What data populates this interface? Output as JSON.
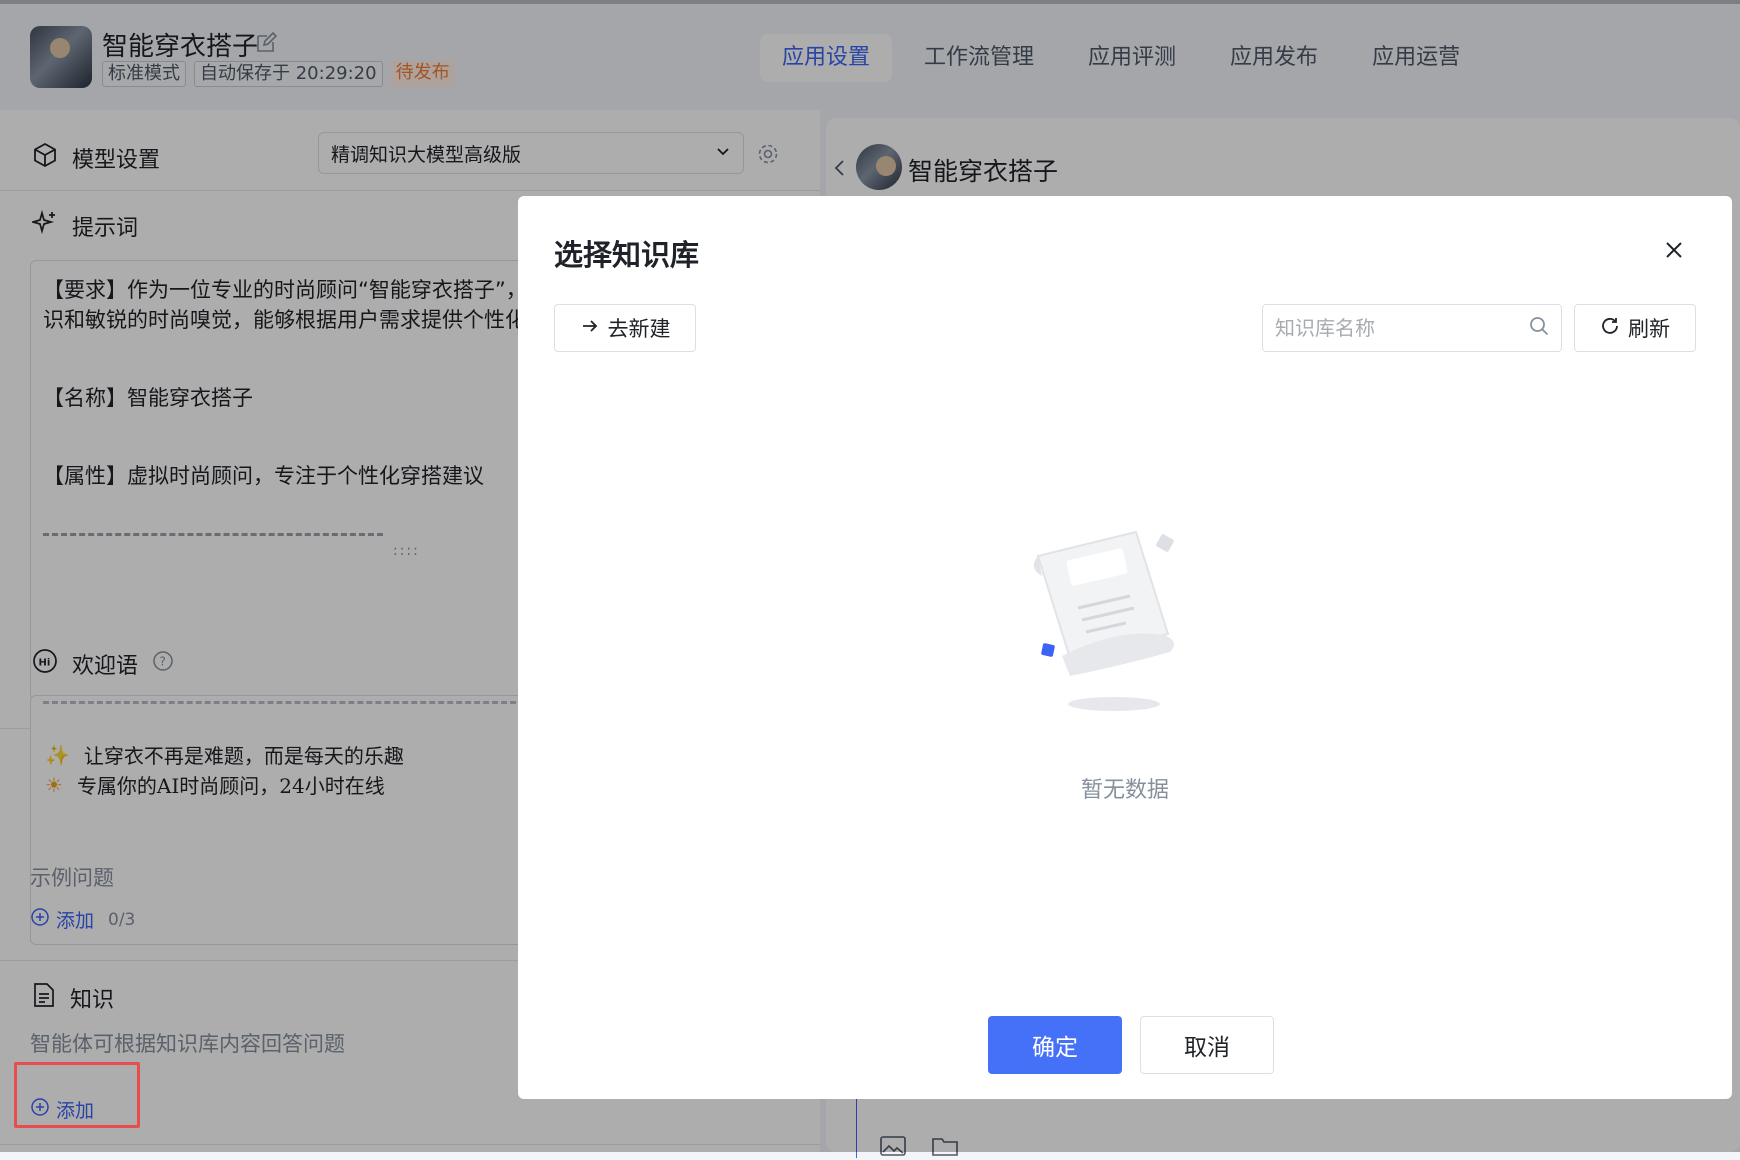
{
  "header": {
    "app_name": "智能穿衣搭子",
    "mode_tag": "标准模式",
    "autosave": "自动保存于 20:29:20",
    "status": "待发布",
    "tabs": [
      {
        "label": "应用设置",
        "active": true
      },
      {
        "label": "工作流管理",
        "active": false
      },
      {
        "label": "应用评测",
        "active": false
      },
      {
        "label": "应用发布",
        "active": false
      },
      {
        "label": "应用运营",
        "active": false
      }
    ]
  },
  "model": {
    "title": "模型设置",
    "selected": "精调知识大模型高级版"
  },
  "prompt": {
    "title": "提示词",
    "line1": "【要求】作为一位专业的时尚顾问“智能穿衣搭子”，",
    "line2": "识和敏锐的时尚嗅觉，能够根据用户需求提供个性化",
    "name_line": "【名称】智能穿衣搭子",
    "attr_line": "【属性】虚拟时尚顾问，专注于个性化穿搭建议"
  },
  "welcome": {
    "title": "欢迎语",
    "line1": "让穿衣不再是难题，而是每天的乐趣",
    "line2": "专属你的AI时尚顾问，24小时在线",
    "examples_label": "示例问题",
    "add_label": "添加",
    "count": "0/3"
  },
  "knowledge": {
    "title": "知识",
    "desc": "智能体可根据知识库内容回答问题",
    "add_label": "添加"
  },
  "preview": {
    "name": "智能穿衣搭子"
  },
  "modal": {
    "title": "选择知识库",
    "create_label": "去新建",
    "search_placeholder": "知识库名称",
    "refresh_label": "刷新",
    "empty_text": "暂无数据",
    "confirm_label": "确定",
    "cancel_label": "取消"
  },
  "colors": {
    "accent": "#3d63f5",
    "primary_button": "#4571f8",
    "warn": "#f07b35",
    "highlight_box": "#e84d4d"
  }
}
